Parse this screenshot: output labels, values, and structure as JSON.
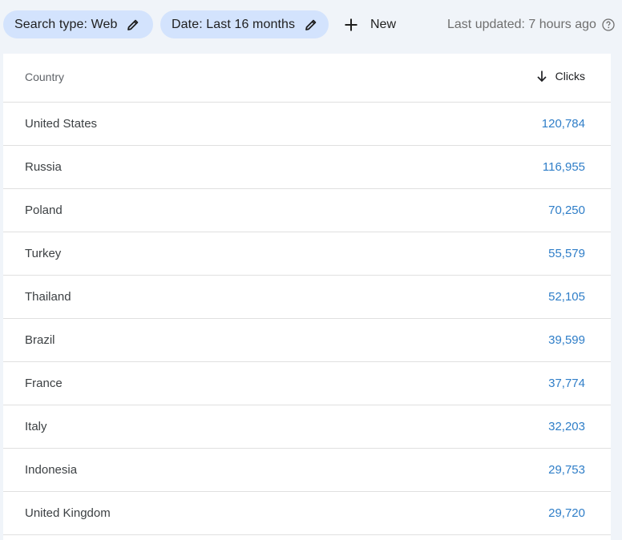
{
  "toolbar": {
    "search_type_chip": "Search type: Web",
    "date_chip": "Date: Last 16 months",
    "new_label": "New",
    "last_updated": "Last updated: 7 hours ago"
  },
  "table": {
    "headers": {
      "country": "Country",
      "clicks": "Clicks"
    },
    "sort": "clicks-descending",
    "rows": [
      {
        "country": "United States",
        "clicks": "120,784"
      },
      {
        "country": "Russia",
        "clicks": "116,955"
      },
      {
        "country": "Poland",
        "clicks": "70,250"
      },
      {
        "country": "Turkey",
        "clicks": "55,579"
      },
      {
        "country": "Thailand",
        "clicks": "52,105"
      },
      {
        "country": "Brazil",
        "clicks": "39,599"
      },
      {
        "country": "France",
        "clicks": "37,774"
      },
      {
        "country": "Italy",
        "clicks": "32,203"
      },
      {
        "country": "Indonesia",
        "clicks": "29,753"
      },
      {
        "country": "United Kingdom",
        "clicks": "29,720"
      }
    ]
  },
  "icons": [
    "pencil-icon",
    "plus-icon",
    "help-icon",
    "arrow-down-icon"
  ],
  "colors": {
    "background": "#f0f4f9",
    "chip": "#d3e3fd",
    "clicks_value": "#2f7ec8"
  }
}
